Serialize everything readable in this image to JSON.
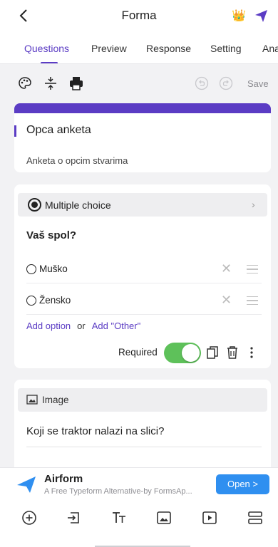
{
  "header": {
    "title": "Forma"
  },
  "tabs": [
    {
      "label": "Questions",
      "active": true
    },
    {
      "label": "Preview"
    },
    {
      "label": "Response"
    },
    {
      "label": "Setting"
    },
    {
      "label": "Ana"
    }
  ],
  "toolbar": {
    "save_label": "Save"
  },
  "form": {
    "title": "Opca anketa",
    "description": "Anketa o opcim stvarima"
  },
  "question": {
    "type_label": "Multiple choice",
    "text": "Vaš spol?",
    "options": [
      "Muško",
      "Žensko"
    ],
    "add_option": "Add option",
    "or": "or",
    "add_other": "Add \"Other\"",
    "required_label": "Required",
    "required_on": true
  },
  "image_question": {
    "type_label": "Image",
    "text": "Koji se traktor nalazi na slici?"
  },
  "ad": {
    "title": "Airform",
    "subtitle": "A Free Typeform Alternative-by FormsAp...",
    "button_label": "Open >"
  },
  "colors": {
    "accent": "#5b3cc4",
    "toggle_on": "#5ec15a",
    "ad_button": "#2f8ff0",
    "crown": "#e9a82a"
  },
  "icons": {
    "header": [
      "back-arrow-icon",
      "crown-icon",
      "send-icon"
    ],
    "toolbar": [
      "palette-icon",
      "spacing-icon",
      "print-icon",
      "undo-icon",
      "redo-icon"
    ],
    "question_actions": [
      "copy-icon",
      "delete-icon",
      "more-icon"
    ],
    "bottom_bar": [
      "add-circle-icon",
      "import-icon",
      "text-icon",
      "image-icon",
      "video-icon",
      "section-icon"
    ]
  }
}
